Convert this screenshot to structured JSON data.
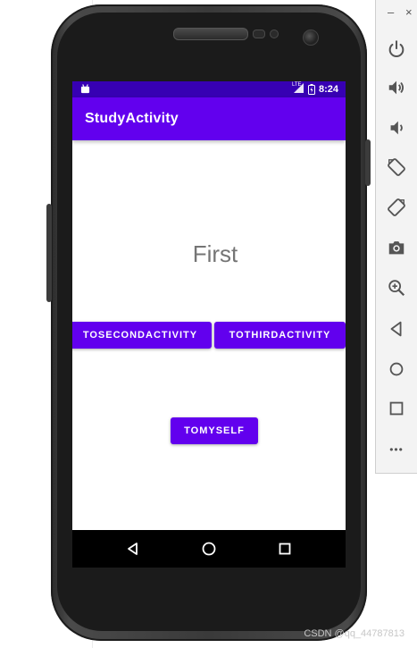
{
  "emulator": {
    "minimize_label": "–",
    "close_label": "×",
    "buttons": [
      {
        "name": "power-icon"
      },
      {
        "name": "volume-up-icon"
      },
      {
        "name": "volume-down-icon"
      },
      {
        "name": "rotate-left-icon"
      },
      {
        "name": "rotate-right-icon"
      },
      {
        "name": "camera-icon"
      },
      {
        "name": "zoom-icon"
      },
      {
        "name": "back-icon"
      },
      {
        "name": "home-icon"
      },
      {
        "name": "overview-icon"
      },
      {
        "name": "more-icon"
      }
    ],
    "more_label": "•••"
  },
  "status_bar": {
    "time": "8:24",
    "network_label": "LTE"
  },
  "app_bar": {
    "title": "StudyActivity"
  },
  "content": {
    "text": "First"
  },
  "buttons": {
    "to_second": "TOSECONDACTIVITY",
    "to_third": "TOTHIRDACTIVITY",
    "to_myself": "TOMYSELF"
  },
  "colors": {
    "primary": "#6200ee",
    "primary_dark": "#3700b3"
  },
  "watermark": "CSDN @qq_44787813"
}
